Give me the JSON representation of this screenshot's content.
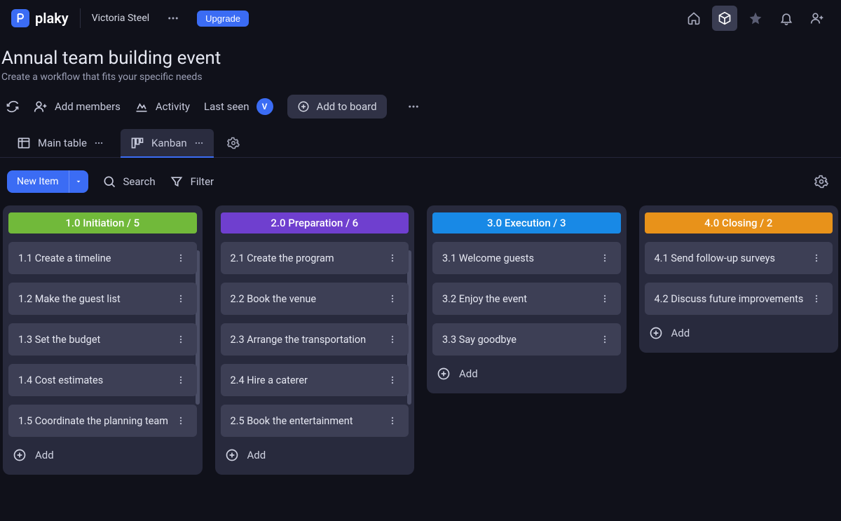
{
  "app": {
    "name": "plaky"
  },
  "user": {
    "name": "Victoria Steel",
    "initial": "V"
  },
  "upgrade_label": "Upgrade",
  "board": {
    "title": "Annual team building event",
    "subtitle": "Create a workflow that fits your specific needs"
  },
  "toolbar": {
    "add_members": "Add members",
    "activity": "Activity",
    "last_seen": "Last seen",
    "add_to_board": "Add to board"
  },
  "views": {
    "main_table": "Main table",
    "kanban": "Kanban"
  },
  "actions": {
    "new_item": "New Item",
    "search": "Search",
    "filter": "Filter",
    "add": "Add"
  },
  "columns": [
    {
      "title": "1.0 Initiation / 5",
      "color": "#71b93a",
      "cards": [
        "1.1 Create a timeline",
        "1.2 Make the guest list",
        "1.3 Set the budget",
        "1.4 Cost estimates",
        "1.5 Coordinate the planning team"
      ]
    },
    {
      "title": "2.0 Preparation / 6",
      "color": "#6f3fcf",
      "cards": [
        "2.1 Create the program",
        "2.2 Book the venue",
        "2.3 Arrange the transportation",
        "2.4 Hire a caterer",
        "2.5 Book the entertainment"
      ]
    },
    {
      "title": "3.0 Execution / 3",
      "color": "#1889e6",
      "cards": [
        "3.1 Welcome guests",
        "3.2 Enjoy the event",
        "3.3 Say goodbye"
      ]
    },
    {
      "title": "4.0 Closing / 2",
      "color": "#e8921a",
      "cards": [
        "4.1 Send follow-up surveys",
        "4.2 Discuss future improvements"
      ]
    }
  ]
}
